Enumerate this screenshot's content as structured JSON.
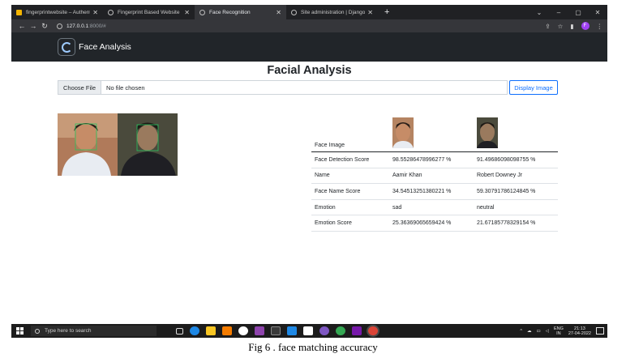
{
  "browser": {
    "tabs": [
      {
        "title": "fingerprintwebsite – Authenticati",
        "icon": "folder-icon",
        "color": "#f4b400",
        "active": false
      },
      {
        "title": "Fingerprint Based Website",
        "icon": "globe-icon",
        "color": "#bdbdbd",
        "active": false
      },
      {
        "title": "Face Recognition",
        "icon": "globe-icon",
        "color": "#bdbdbd",
        "active": true
      },
      {
        "title": "Site administration | Django site",
        "icon": "globe-icon",
        "color": "#bdbdbd",
        "active": false
      }
    ],
    "new_tab_label": "+",
    "url_host": "127.0.0.1",
    "url_path": ":8000/#",
    "profile_initial": "F"
  },
  "navbar": {
    "brand": "Face Analysis"
  },
  "page": {
    "title": "Facial Analysis",
    "file_button": "Choose File",
    "file_status": "No file chosen",
    "display_button": "Display Image"
  },
  "results": {
    "header_label": "Face Image",
    "rows": [
      {
        "label": "Face Detection Score",
        "values": [
          "98.55286478996277 %",
          "91.49686098098755 %"
        ]
      },
      {
        "label": "Name",
        "values": [
          "Aamir Khan",
          "Robert Downey Jr"
        ]
      },
      {
        "label": "Face Name Score",
        "values": [
          "34.54513251380221 %",
          "59.30791786124845 %"
        ]
      },
      {
        "label": "Emotion",
        "values": [
          "sad",
          "neutral"
        ]
      },
      {
        "label": "Emotion Score",
        "values": [
          "25.36369065659424 %",
          "21.67185778329154 %"
        ]
      }
    ]
  },
  "taskbar": {
    "search_placeholder": "Type here to search",
    "lang_top": "ENG",
    "lang_bottom": "IN",
    "time": "21:13",
    "date": "27-04-2022"
  },
  "caption": "Fig 6 . face matching accuracy"
}
